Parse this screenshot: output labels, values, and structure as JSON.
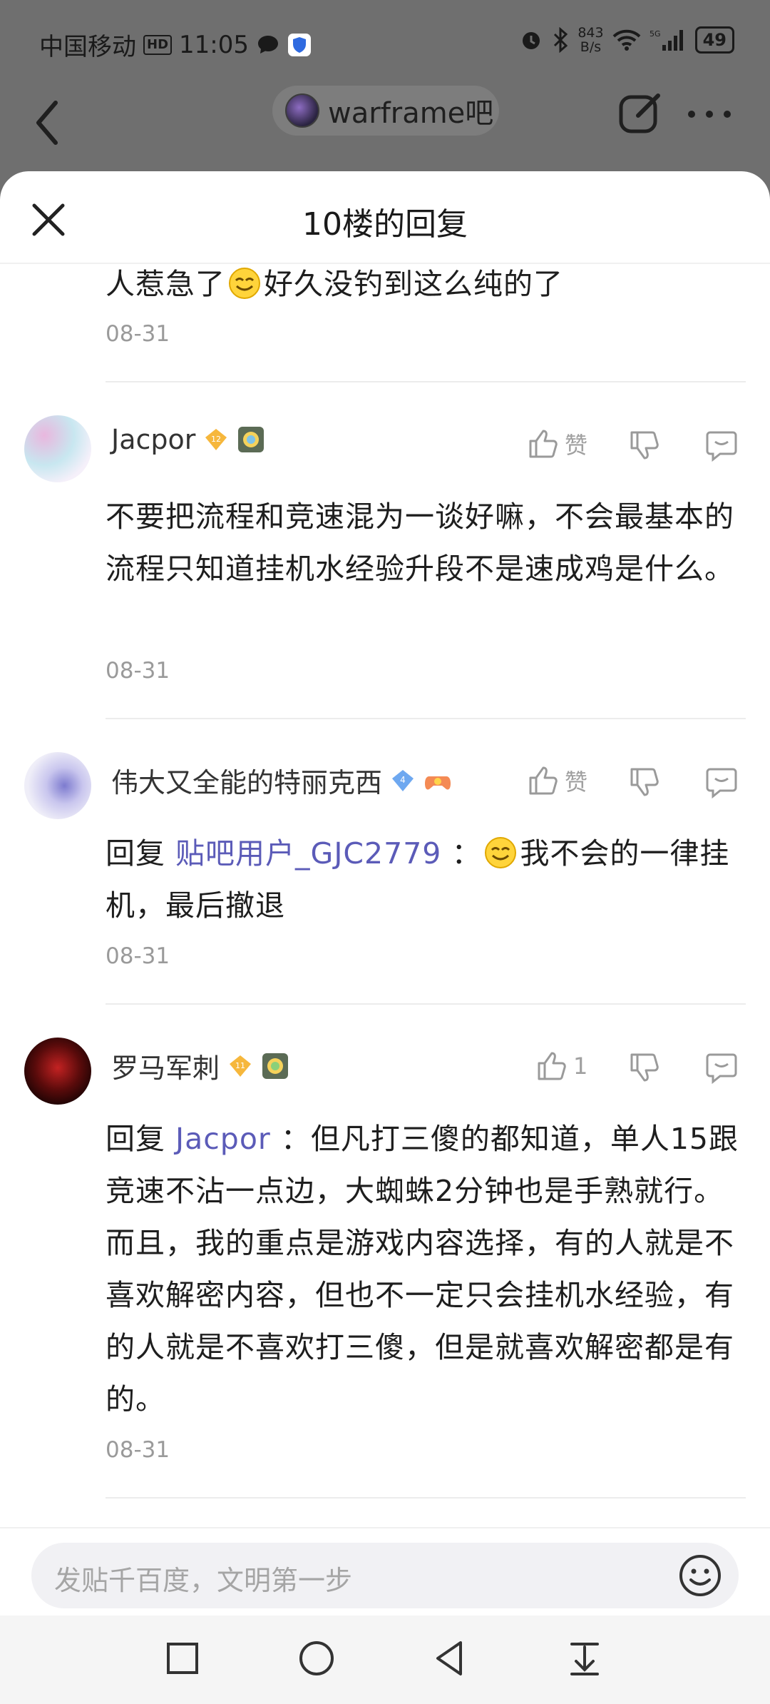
{
  "status_bar": {
    "carrier": "中国移动",
    "hd": "HD",
    "time": "11:05",
    "net_speed_value": "843",
    "net_speed_unit": "B/s",
    "battery": "49"
  },
  "app_bar": {
    "forum_name": "warframe吧"
  },
  "sheet": {
    "title": "10楼的回复"
  },
  "replies": [
    {
      "text_before": "人惹急了",
      "text_after": "好久没钓到这么纯的了",
      "date": "08-31"
    },
    {
      "username": "Jacpor",
      "level": "12",
      "like_label": "赞",
      "text": "不要把流程和竞速混为一谈好嘛，不会最基本的流程只知道挂机水经验升段不是速成鸡是什么。",
      "date": "08-31"
    },
    {
      "username": "伟大又全能的特丽克西",
      "level": "4",
      "like_label": "赞",
      "reply_prefix": "回复",
      "mention": "贴吧用户_GJC2779",
      "colon": "：",
      "text": "我不会的一律挂机，最后撤退",
      "date": "08-31"
    },
    {
      "username": "罗马军刺",
      "level": "11",
      "like_count": "1",
      "reply_prefix": "回复",
      "mention": "Jacpor",
      "text": "：但凡打三傻的都知道，单人15跟竞速不沾一点边，大蜘蛛2分钟也是手熟就行。而且，我的重点是游戏内容选择，有的人就是不喜欢解密内容，但也不一定只会挂机水经验，有的人就是不喜欢打三傻，但是就喜欢解密都是有的。",
      "date": "08-31"
    }
  ],
  "input": {
    "placeholder": "发贴千百度，文明第一步"
  }
}
